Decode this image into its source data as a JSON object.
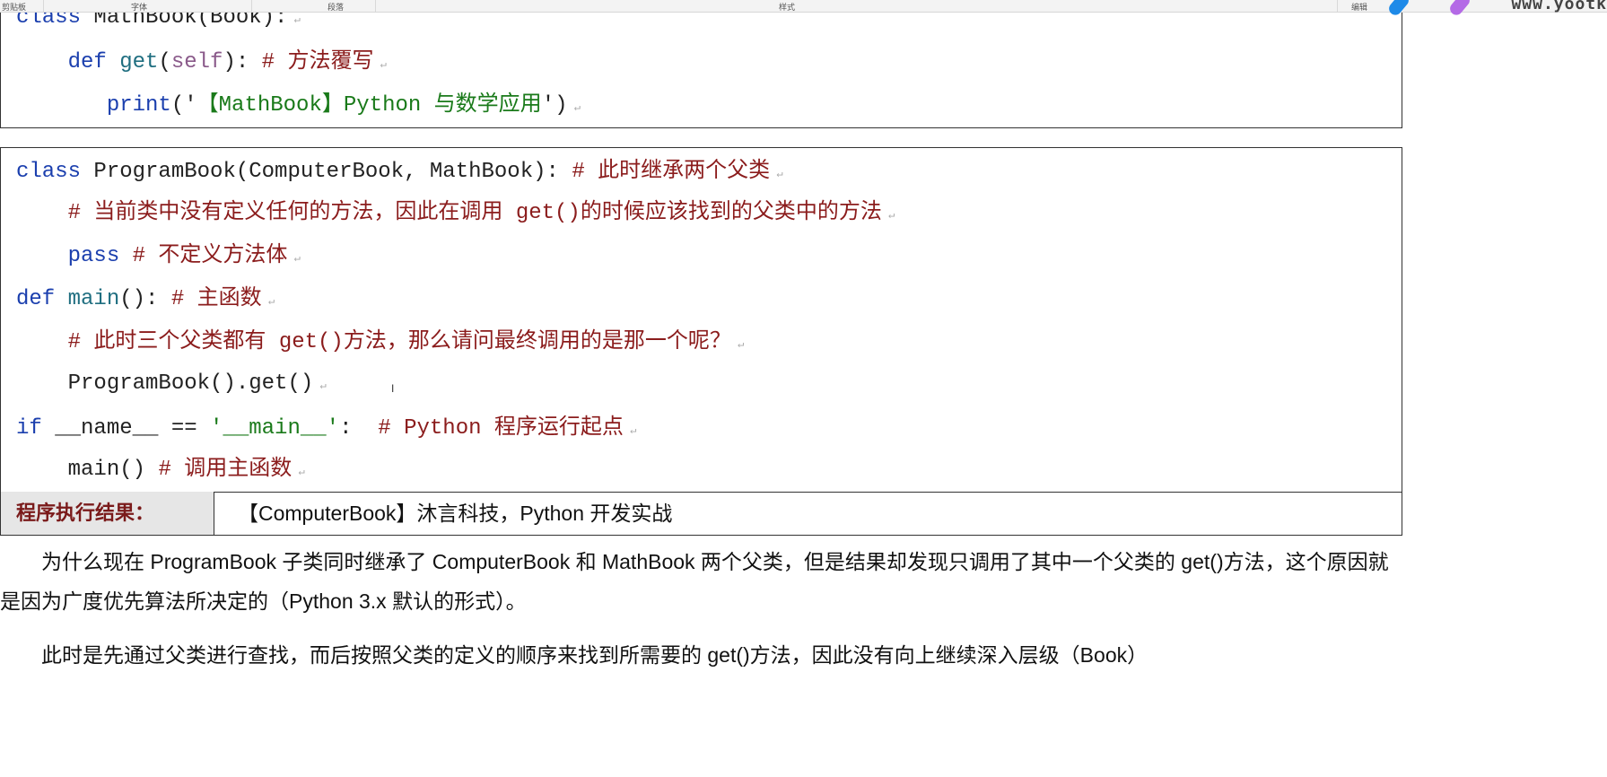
{
  "ribbon": {
    "groups": [
      "剪贴板",
      "字体",
      "段落",
      "样式",
      "编辑"
    ],
    "watermark": "www.yootk"
  },
  "box1": [
    [
      {
        "t": "class ",
        "c": "kw"
      },
      {
        "t": "MathBook(Book):",
        "c": "pl"
      }
    ],
    [
      {
        "t": "    def ",
        "c": "kw"
      },
      {
        "t": "get",
        "c": "fn"
      },
      {
        "t": "(",
        "c": "pl"
      },
      {
        "t": "self",
        "c": "self"
      },
      {
        "t": "): ",
        "c": "pl"
      },
      {
        "t": "# 方法覆写",
        "c": "cm"
      }
    ],
    [
      {
        "t": "       print",
        "c": "kw"
      },
      {
        "t": "('",
        "c": "pl"
      },
      {
        "t": "【MathBook】Python 与数学应用",
        "c": "str"
      },
      {
        "t": "')",
        "c": "pl"
      }
    ]
  ],
  "box2": [
    [
      {
        "t": "class ",
        "c": "kw"
      },
      {
        "t": "ProgramBook(ComputerBook, MathBook): ",
        "c": "pl"
      },
      {
        "t": "# 此时继承两个父类",
        "c": "cm"
      }
    ],
    [
      {
        "t": "    # 当前类中没有定义任何的方法，因此在调用 get()的时候应该找到的父类中的方法",
        "c": "cm"
      }
    ],
    [
      {
        "t": "    pass ",
        "c": "kw"
      },
      {
        "t": "# 不定义方法体",
        "c": "cm"
      }
    ],
    [
      {
        "t": "def ",
        "c": "kw"
      },
      {
        "t": "main",
        "c": "fn"
      },
      {
        "t": "(): ",
        "c": "pl"
      },
      {
        "t": "# 主函数",
        "c": "cm"
      }
    ],
    [
      {
        "t": "    # 此时三个父类都有 get()方法，那么请问最终调用的是那一个呢？",
        "c": "cm"
      }
    ],
    [
      {
        "t": "    ProgramBook().get()",
        "c": "pl"
      }
    ],
    [
      {
        "t": "if ",
        "c": "kw"
      },
      {
        "t": "__name__ == ",
        "c": "pl"
      },
      {
        "t": "'__main__'",
        "c": "str"
      },
      {
        "t": ":  ",
        "c": "pl"
      },
      {
        "t": "# Python 程序运行起点",
        "c": "cm"
      }
    ],
    [
      {
        "t": "    main() ",
        "c": "pl"
      },
      {
        "t": "# 调用主函数",
        "c": "cm"
      }
    ]
  ],
  "result": {
    "label": "程序执行结果：",
    "value": "【ComputerBook】沐言科技，Python 开发实战"
  },
  "paragraphs": [
    "　　为什么现在 ProgramBook 子类同时继承了 ComputerBook 和 MathBook 两个父类，但是结果却发现只调用了其中一个父类的 get()方法，这个原因就是因为广度优先算法所决定的（Python 3.x 默认的形式）。",
    "　　此时是先通过父类进行查找，而后按照父类的定义的顺序来找到所需要的 get()方法，因此没有向上继续深入层级（Book）"
  ]
}
